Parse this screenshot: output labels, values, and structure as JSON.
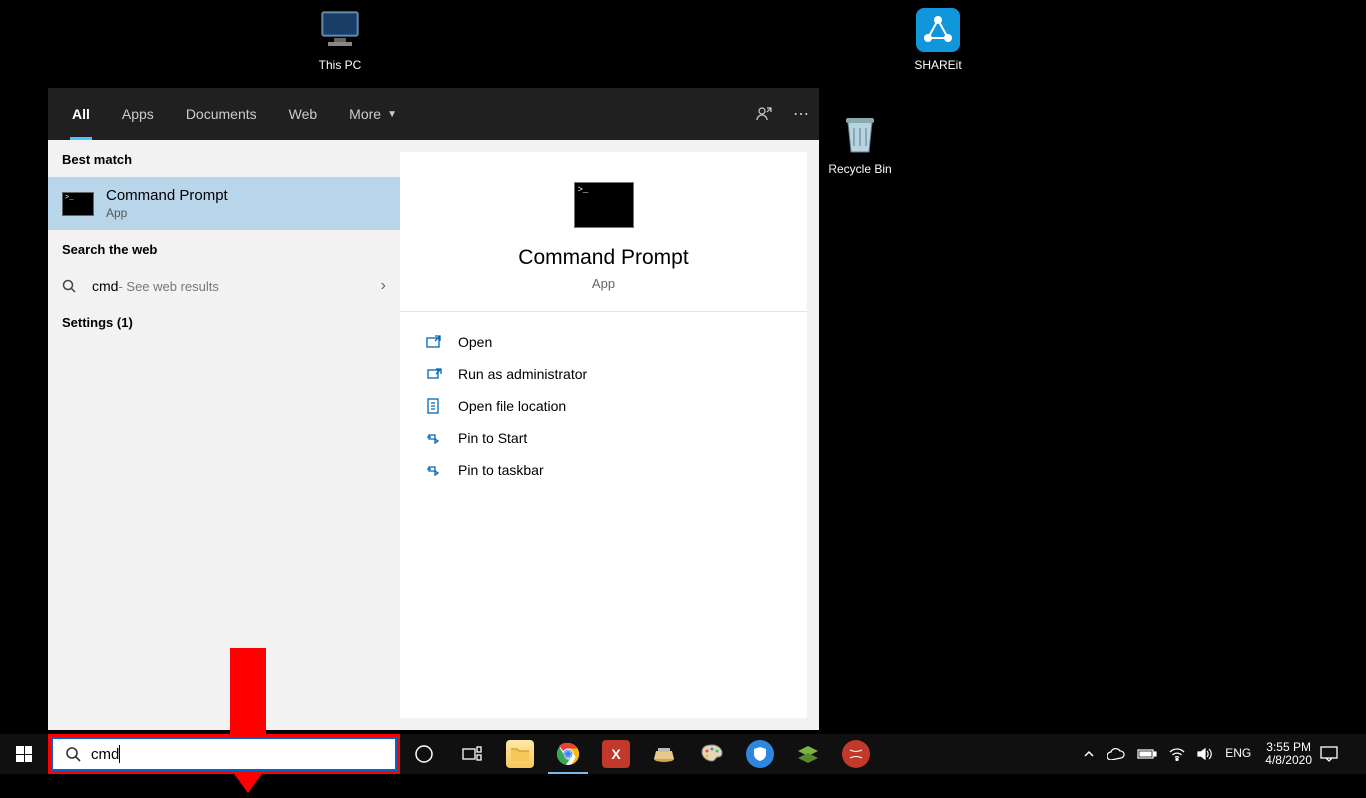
{
  "desktop": {
    "this_pc": "This PC",
    "shareit": "SHAREit",
    "recycle_bin": "Recycle Bin"
  },
  "search_panel": {
    "tabs": {
      "all": "All",
      "apps": "Apps",
      "documents": "Documents",
      "web": "Web",
      "more": "More"
    },
    "sections": {
      "best_match": "Best match",
      "search_web": "Search the web",
      "settings": "Settings (1)"
    },
    "best_match": {
      "title": "Command Prompt",
      "sub": "App"
    },
    "web": {
      "query": "cmd",
      "hint": " - See web results"
    },
    "preview": {
      "title": "Command Prompt",
      "sub": "App",
      "actions": {
        "open": "Open",
        "admin": "Run as administrator",
        "location": "Open file location",
        "pin_start": "Pin to Start",
        "pin_taskbar": "Pin to taskbar"
      }
    }
  },
  "taskbar": {
    "search_value": "cmd"
  },
  "systray": {
    "lang": "ENG",
    "time": "3:55 PM",
    "date": "4/8/2020"
  }
}
